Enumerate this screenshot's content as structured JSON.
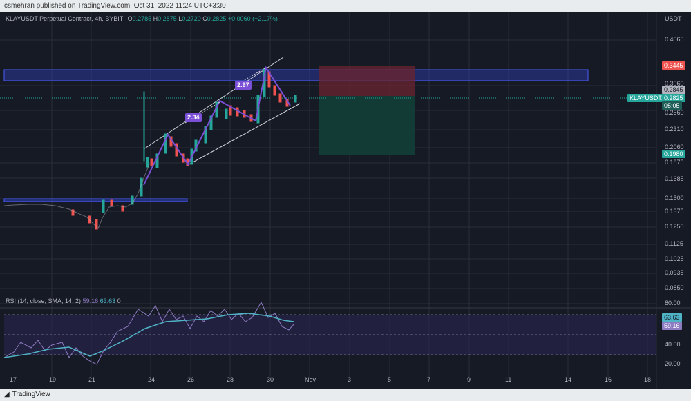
{
  "topbar": {
    "text": "csmehran published on TradingView.com, Oct 31, 2022 11:24 UTC+3:30"
  },
  "legend": {
    "symbol": "KLAYUSDT Perpetual Contract, 4h, BYBIT",
    "o_label": "O",
    "o_value": "0.2785",
    "h_label": "H",
    "h_value": "0.2875",
    "l_label": "L",
    "l_value": "0.2720",
    "c_label": "C",
    "c_value": "0.2825",
    "change": "+0.0060 (+2.17%)"
  },
  "price_axis": {
    "currency": "USDT",
    "ticks": [
      "0.4065",
      "0.3060",
      "0.2560",
      "0.2310",
      "0.2060",
      "0.1875",
      "0.1685",
      "0.1500",
      "0.1375",
      "0.1250",
      "0.1125",
      "0.1025",
      "0.0935",
      "0.0850"
    ],
    "tags": {
      "stop": "0.3445",
      "last": "0.2845",
      "symbol": "KLAYUSDT.P",
      "current": "0.2825",
      "countdown": "05:05",
      "target": "0.1980"
    }
  },
  "rsi": {
    "title": "RSI (14, close, SMA, 14, 2)",
    "v1": "59.16",
    "v2": "63.63",
    "v3": "0",
    "ticks": [
      "80.00",
      "40.00",
      "20.00"
    ],
    "tags": {
      "sma": "63.63",
      "rsi": "59.16"
    }
  },
  "annotations": {
    "label1": "2.34",
    "label2": "2.97"
  },
  "time_axis": [
    "17",
    "19",
    "21",
    "24",
    "26",
    "28",
    "30",
    "Nov",
    "3",
    "5",
    "7",
    "9",
    "11",
    "14",
    "16",
    "18"
  ],
  "footer": {
    "brand": "TradingView"
  },
  "colors": {
    "bg": "#161a25",
    "up": "#26a69a",
    "down": "#ef5350",
    "zone_blue": "#2f3fb3",
    "zone_red": "#6b2430",
    "zone_green": "#123f38",
    "pattern": "#7b4fd6",
    "rsi_line": "#8e7cc3",
    "rsi_sma": "#4fb3c6"
  }
}
